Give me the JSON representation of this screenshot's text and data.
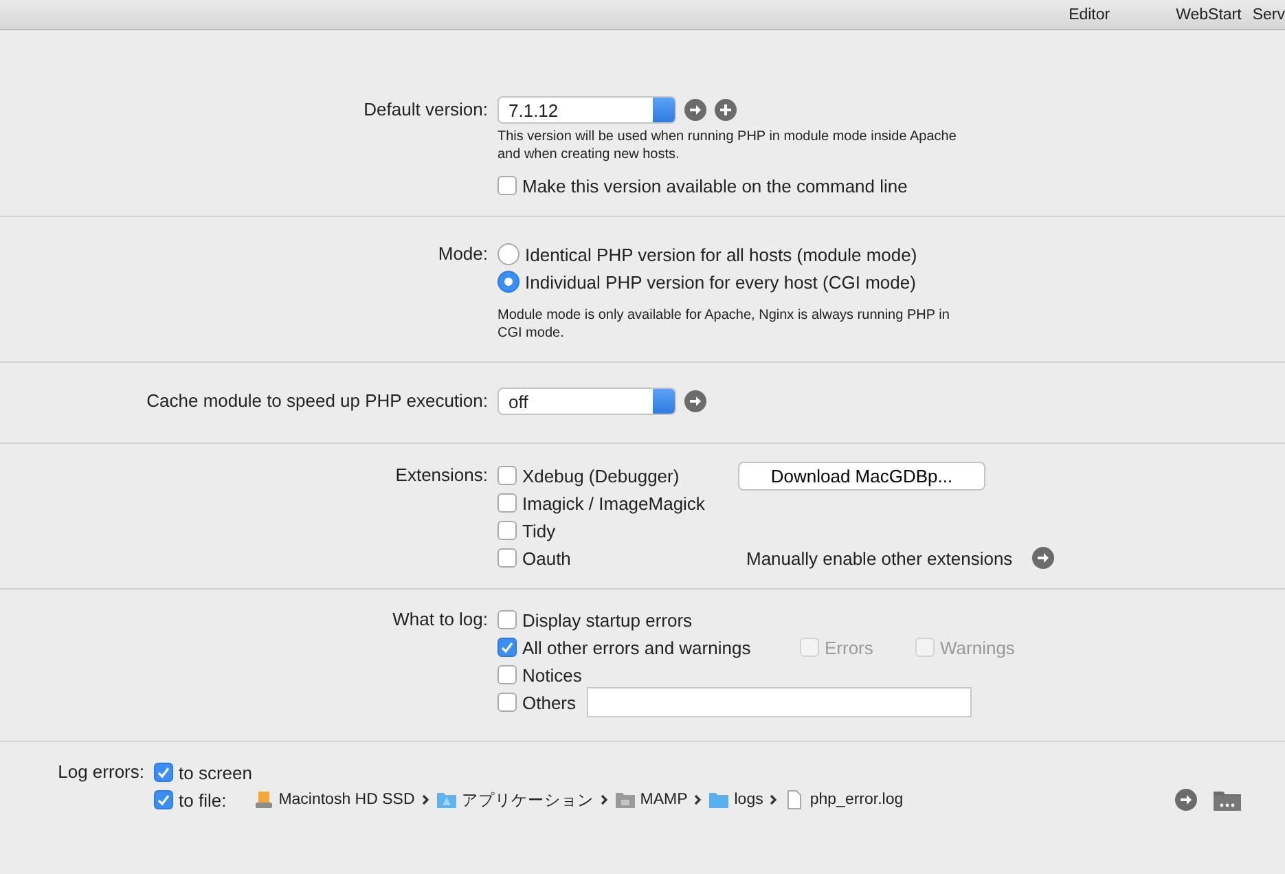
{
  "tabs": [
    {
      "label": "Editor"
    },
    {
      "label": "WebStart"
    },
    {
      "label": "Serv"
    }
  ],
  "default_version": {
    "label": "Default version:",
    "value": "7.1.12",
    "note": "This version will be used when running PHP in module mode inside Apache and when creating new hosts.",
    "command_line": {
      "label": "Make this version available on the command line",
      "checked": false
    }
  },
  "mode": {
    "label": "Mode:",
    "options": [
      {
        "label": "Identical PHP version for all hosts (module mode)",
        "selected": false
      },
      {
        "label": "Individual PHP version for every host (CGI mode)",
        "selected": true
      }
    ],
    "note": "Module mode is only available for Apache, Nginx is always running PHP in CGI mode."
  },
  "cache": {
    "label": "Cache module to speed up PHP execution:",
    "value": "off"
  },
  "extensions": {
    "label": "Extensions:",
    "items": [
      {
        "label": "Xdebug (Debugger)",
        "checked": false
      },
      {
        "label": "Imagick / ImageMagick",
        "checked": false
      },
      {
        "label": "Tidy",
        "checked": false
      },
      {
        "label": "Oauth",
        "checked": false
      }
    ],
    "download_button": "Download MacGDBp...",
    "manual_link": "Manually enable other extensions"
  },
  "what_to_log": {
    "label": "What to log:",
    "items": [
      {
        "kind": "checkbox",
        "label": "Display startup errors",
        "checked": false
      },
      {
        "kind": "checkbox",
        "label": "All other errors and warnings",
        "checked": true,
        "sub": [
          {
            "label": "Errors",
            "checked": false,
            "disabled": true
          },
          {
            "label": "Warnings",
            "checked": false,
            "disabled": true
          }
        ]
      },
      {
        "kind": "checkbox",
        "label": "Notices",
        "checked": false
      },
      {
        "kind": "checkbox-field",
        "label": "Others",
        "checked": false
      }
    ]
  },
  "log_errors": {
    "label": "Log errors:",
    "to_screen": {
      "label": "to screen",
      "checked": true
    },
    "to_file": {
      "label": "to file:",
      "checked": true,
      "path": [
        {
          "kind": "disk",
          "name": "Macintosh HD SSD"
        },
        {
          "kind": "app-folder",
          "name": "アプリケーション"
        },
        {
          "kind": "grey-folder",
          "name": "MAMP"
        },
        {
          "kind": "folder",
          "name": "logs"
        },
        {
          "kind": "file",
          "name": "php_error.log"
        }
      ]
    }
  }
}
